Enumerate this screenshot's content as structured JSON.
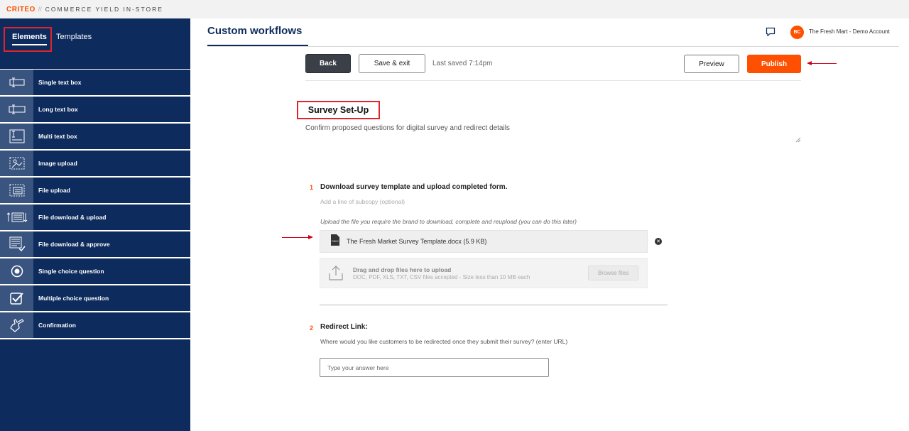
{
  "brand": {
    "logo": "CRITEO",
    "separator": "//",
    "product": "COMMERCE YIELD IN-STORE",
    "accent_color": "#fe5000",
    "navy_color": "#0d2b5c"
  },
  "sidebar": {
    "tabs": [
      {
        "label": "Elements",
        "active": true
      },
      {
        "label": "Templates",
        "active": false
      }
    ],
    "items": [
      {
        "label": "Single text box",
        "icon": "single-text-box-icon"
      },
      {
        "label": "Long text box",
        "icon": "long-text-box-icon"
      },
      {
        "label": "Multi text box",
        "icon": "multi-text-box-icon"
      },
      {
        "label": "Image upload",
        "icon": "image-upload-icon"
      },
      {
        "label": "File upload",
        "icon": "file-upload-icon"
      },
      {
        "label": "File download & upload",
        "icon": "file-download-upload-icon"
      },
      {
        "label": "File download & approve",
        "icon": "file-download-approve-icon"
      },
      {
        "label": "Single choice question",
        "icon": "radio-icon"
      },
      {
        "label": "Multiple choice question",
        "icon": "checkbox-icon"
      },
      {
        "label": "Confirmation",
        "icon": "pointing-hand-icon"
      }
    ]
  },
  "header": {
    "title": "Custom workflows",
    "avatar_initials": "BC",
    "account_name": "The Fresh Mart - Demo Account"
  },
  "toolbar": {
    "back_label": "Back",
    "save_label": "Save & exit",
    "last_saved": "Last saved 7:14pm",
    "preview_label": "Preview",
    "publish_label": "Publish"
  },
  "section": {
    "title": "Survey Set-Up",
    "description": "Confirm proposed questions for digital survey and redirect details"
  },
  "questions": [
    {
      "number": "1",
      "title": "Download survey template and upload completed form.",
      "subcopy_placeholder": "Add a line of subcopy (optional)",
      "hint": "Upload the file you require the brand to download, complete and reupload (you can do this later)",
      "file": {
        "name": "The Fresh Market Survey Template.docx (5.9 KB)",
        "badge": "DOCX"
      },
      "dropzone": {
        "title": "Drag and drop files here to upload",
        "subtitle": "DOC, PDF, XLS, TXT, CSV files accepted - Size less than 10 MB each",
        "browse_label": "Browse files"
      }
    },
    {
      "number": "2",
      "title": "Redirect Link:",
      "subtitle": "Where would you like customers to be redirected once they submit their survey? (enter URL)",
      "input_value": "",
      "input_placeholder": "Type your answer here"
    }
  ]
}
